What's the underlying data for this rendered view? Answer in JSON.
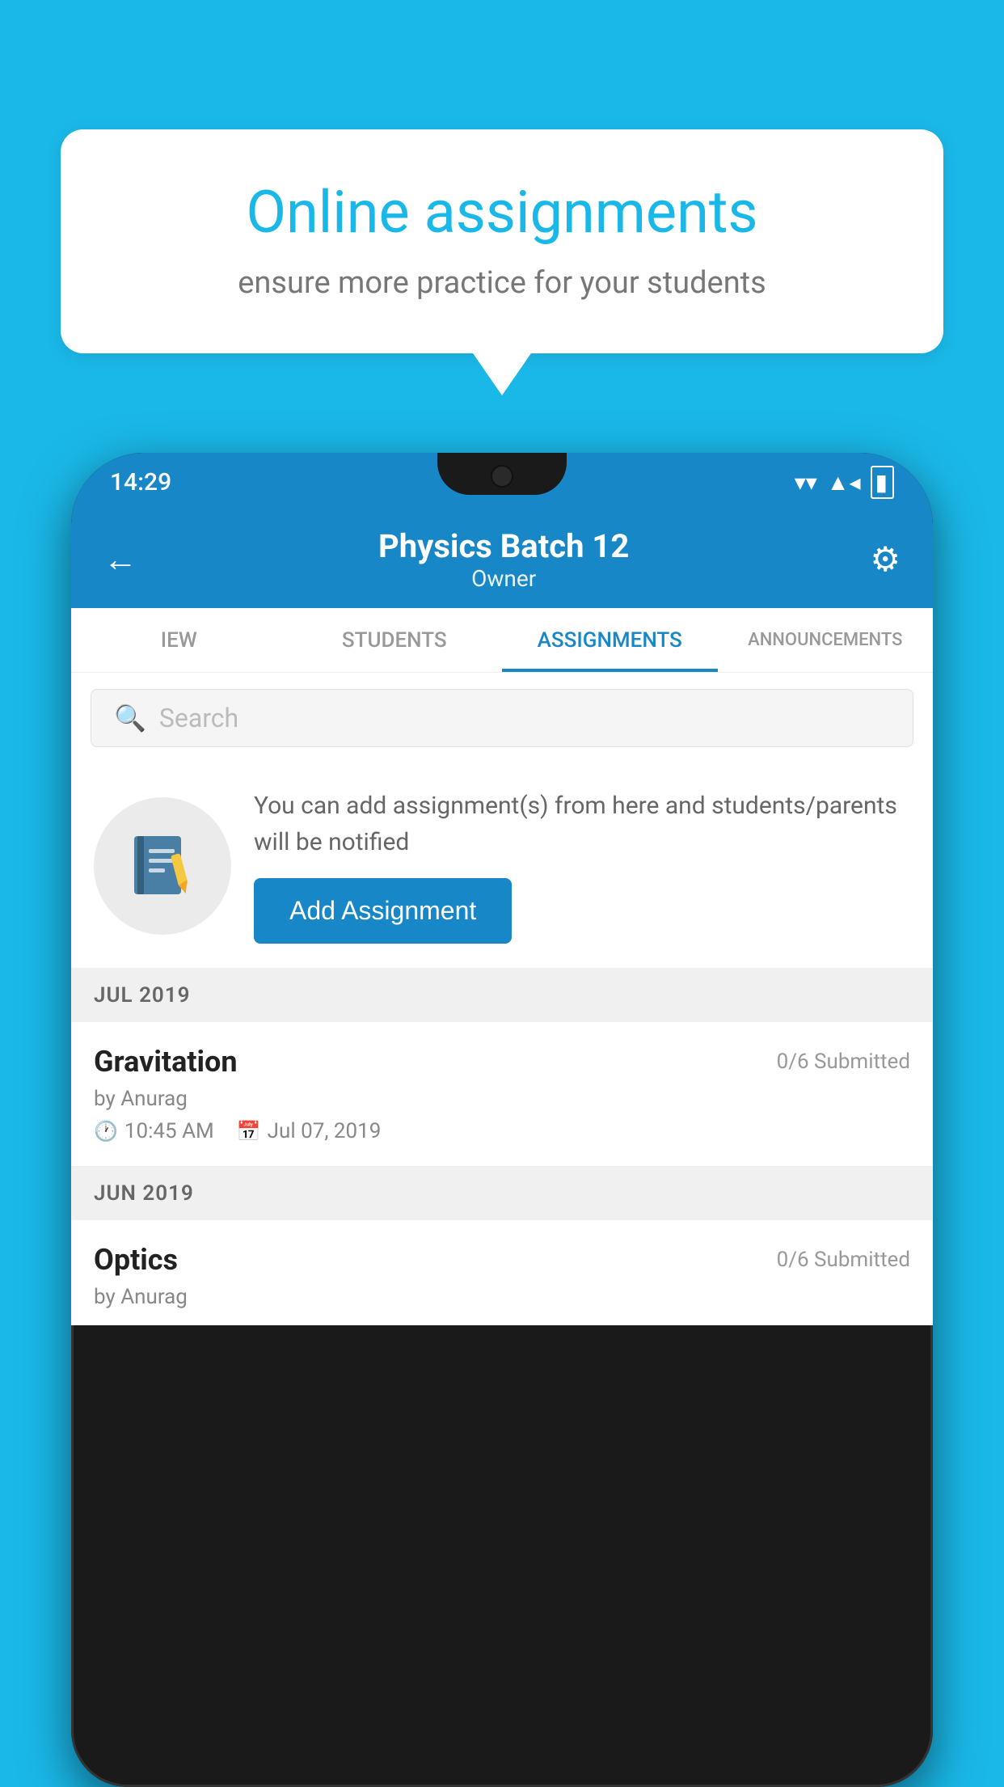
{
  "background": {
    "color": "#1ab8e8"
  },
  "speech_bubble": {
    "title": "Online assignments",
    "subtitle": "ensure more practice for your students"
  },
  "phone": {
    "status_bar": {
      "time": "14:29",
      "wifi_icon": "▼",
      "signal_icon": "◂",
      "battery_icon": "▮"
    },
    "header": {
      "back_label": "←",
      "title": "Physics Batch 12",
      "subtitle": "Owner",
      "settings_label": "⚙"
    },
    "tabs": [
      {
        "label": "IEW",
        "active": false
      },
      {
        "label": "STUDENTS",
        "active": false
      },
      {
        "label": "ASSIGNMENTS",
        "active": true
      },
      {
        "label": "ANNOUNCEMENTS",
        "active": false
      }
    ],
    "search": {
      "placeholder": "Search"
    },
    "promo": {
      "text": "You can add assignment(s) from here and students/parents will be notified",
      "button_label": "Add Assignment"
    },
    "sections": [
      {
        "label": "JUL 2019",
        "assignments": [
          {
            "name": "Gravitation",
            "submitted": "0/6 Submitted",
            "by": "by Anurag",
            "time": "10:45 AM",
            "date": "Jul 07, 2019"
          }
        ]
      },
      {
        "label": "JUN 2019",
        "assignments": [
          {
            "name": "Optics",
            "submitted": "0/6 Submitted",
            "by": "by Anurag",
            "time": "",
            "date": ""
          }
        ]
      }
    ]
  }
}
